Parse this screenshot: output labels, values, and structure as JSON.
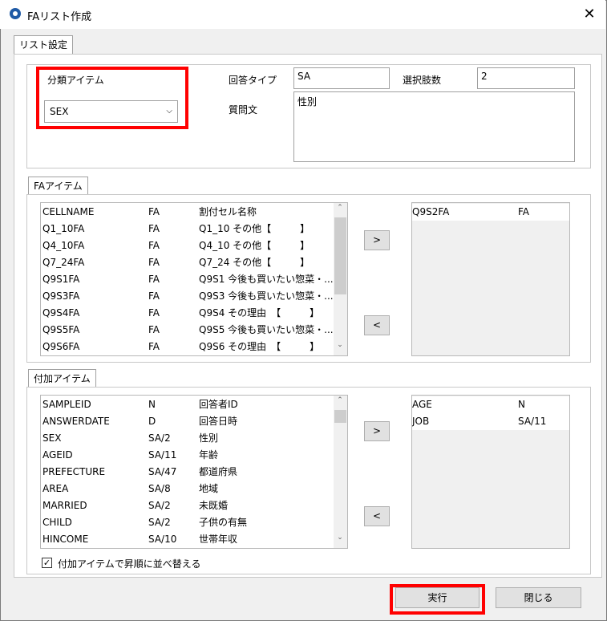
{
  "window": {
    "title": "FAリスト作成",
    "close_label": "✕"
  },
  "tabs": {
    "main": "リスト設定",
    "fa_items": "FAアイテム",
    "additional_items": "付加アイテム"
  },
  "settings": {
    "category_item_label": "分類アイテム",
    "category_item_value": "SEX",
    "answer_type_label": "回答タイプ",
    "answer_type_value": "SA",
    "choice_count_label": "選択肢数",
    "choice_count_value": "2",
    "question_label": "質問文",
    "question_value": "性別"
  },
  "fa_list": [
    [
      "CELLNAME",
      "FA",
      "割付セル名称"
    ],
    [
      "Q1_10FA",
      "FA",
      "Q1_10 その他【　　　】"
    ],
    [
      "Q4_10FA",
      "FA",
      "Q4_10 その他【　　　】"
    ],
    [
      "Q7_24FA",
      "FA",
      "Q7_24 その他【　　　】"
    ],
    [
      "Q9S1FA",
      "FA",
      "Q9S1 今後も買いたい惣菜・..."
    ],
    [
      "Q9S3FA",
      "FA",
      "Q9S3 今後も買いたい惣菜・..."
    ],
    [
      "Q9S4FA",
      "FA",
      "Q9S4 その理由　【　　　】"
    ],
    [
      "Q9S5FA",
      "FA",
      "Q9S5 今後も買いたい惣菜・..."
    ],
    [
      "Q9S6FA",
      "FA",
      "Q9S6 その理由　【　　　】"
    ]
  ],
  "fa_selected": [
    [
      "Q9S2FA",
      "FA"
    ]
  ],
  "add_list": [
    [
      "SAMPLEID",
      "N",
      "回答者ID"
    ],
    [
      "ANSWERDATE",
      "D",
      "回答日時"
    ],
    [
      "SEX",
      "SA/2",
      "性別"
    ],
    [
      "AGEID",
      "SA/11",
      "年齢"
    ],
    [
      "PREFECTURE",
      "SA/47",
      "都道府県"
    ],
    [
      "AREA",
      "SA/8",
      "地域"
    ],
    [
      "MARRIED",
      "SA/2",
      "未既婚"
    ],
    [
      "CHILD",
      "SA/2",
      "子供の有無"
    ],
    [
      "HINCOME",
      "SA/10",
      "世帯年収"
    ]
  ],
  "add_selected": [
    [
      "AGE",
      "N"
    ],
    [
      "JOB",
      "SA/11"
    ]
  ],
  "buttons": {
    "move_right": ">",
    "move_left": "<",
    "run": "実行",
    "close": "閉じる"
  },
  "sort_checkbox": {
    "label": "付加アイテムで昇順に並べ替える",
    "checked": true,
    "mark": "✓"
  },
  "scroll": {
    "up": "⌃",
    "down": "⌄"
  }
}
